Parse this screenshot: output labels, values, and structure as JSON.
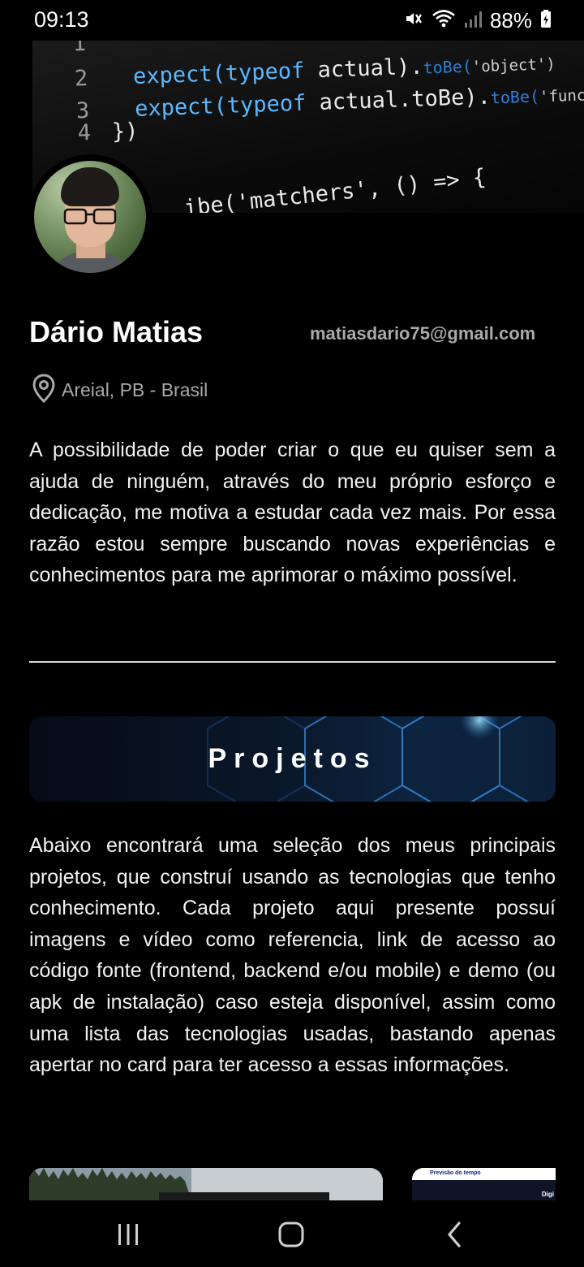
{
  "status_bar": {
    "time": "09:13",
    "battery": "88%",
    "icons": [
      "mute-icon",
      "wifi-icon",
      "signal-icon",
      "battery-charging-icon"
    ]
  },
  "banner": {
    "code_lines": [
      {
        "num": "1",
        "text": ""
      },
      {
        "num": "2",
        "kw": "expect(typeof",
        "id": " actual).",
        "fn": "toBe(",
        "str": "'object')"
      },
      {
        "num": "3",
        "kw": "expect(typeof",
        "id": " actual.toBe).",
        "fn": "toBe(",
        "str": "'function')"
      },
      {
        "num": "4",
        "kw": "",
        "id": "})",
        "fn": "",
        "str": ""
      },
      {
        "num": "",
        "kw": "",
        "id": "ibe('matchers', () => {",
        "fn": "",
        "str": ""
      }
    ]
  },
  "profile": {
    "name": "Dário Matias",
    "email": "matiasdario75@gmail.com",
    "location": "Areial, PB - Brasil",
    "bio": "A possibilidade de poder criar o que eu quiser sem a ajuda de ninguém, através do meu próprio esforço e dedicação, me motiva a estudar cada vez mais. Por essa razão estou sempre buscando novas experiências e conhecimentos para me aprimorar o máximo possível."
  },
  "projects": {
    "title": "Projetos",
    "description": "Abaixo encontrará uma seleção dos meus principais projetos, que construí usando as tecnologias que tenho conhecimento. Cada projeto aqui presente possuí imagens e vídeo como referencia, link de acesso ao código fonte (frontend, backend e/ou mobile) e demo (ou apk de instalação) caso esteja disponível, assim como uma lista das tecnologias usadas, bastando apenas apertar no card para ter acesso a essas informações.",
    "cards": [
      {
        "title": ""
      },
      {
        "title": "Previsão do tempo",
        "label": "Digi"
      }
    ]
  },
  "colors": {
    "background": "#000000",
    "secondary_text": "#a9a9a9",
    "accent_blue": "#5ab8ff"
  }
}
